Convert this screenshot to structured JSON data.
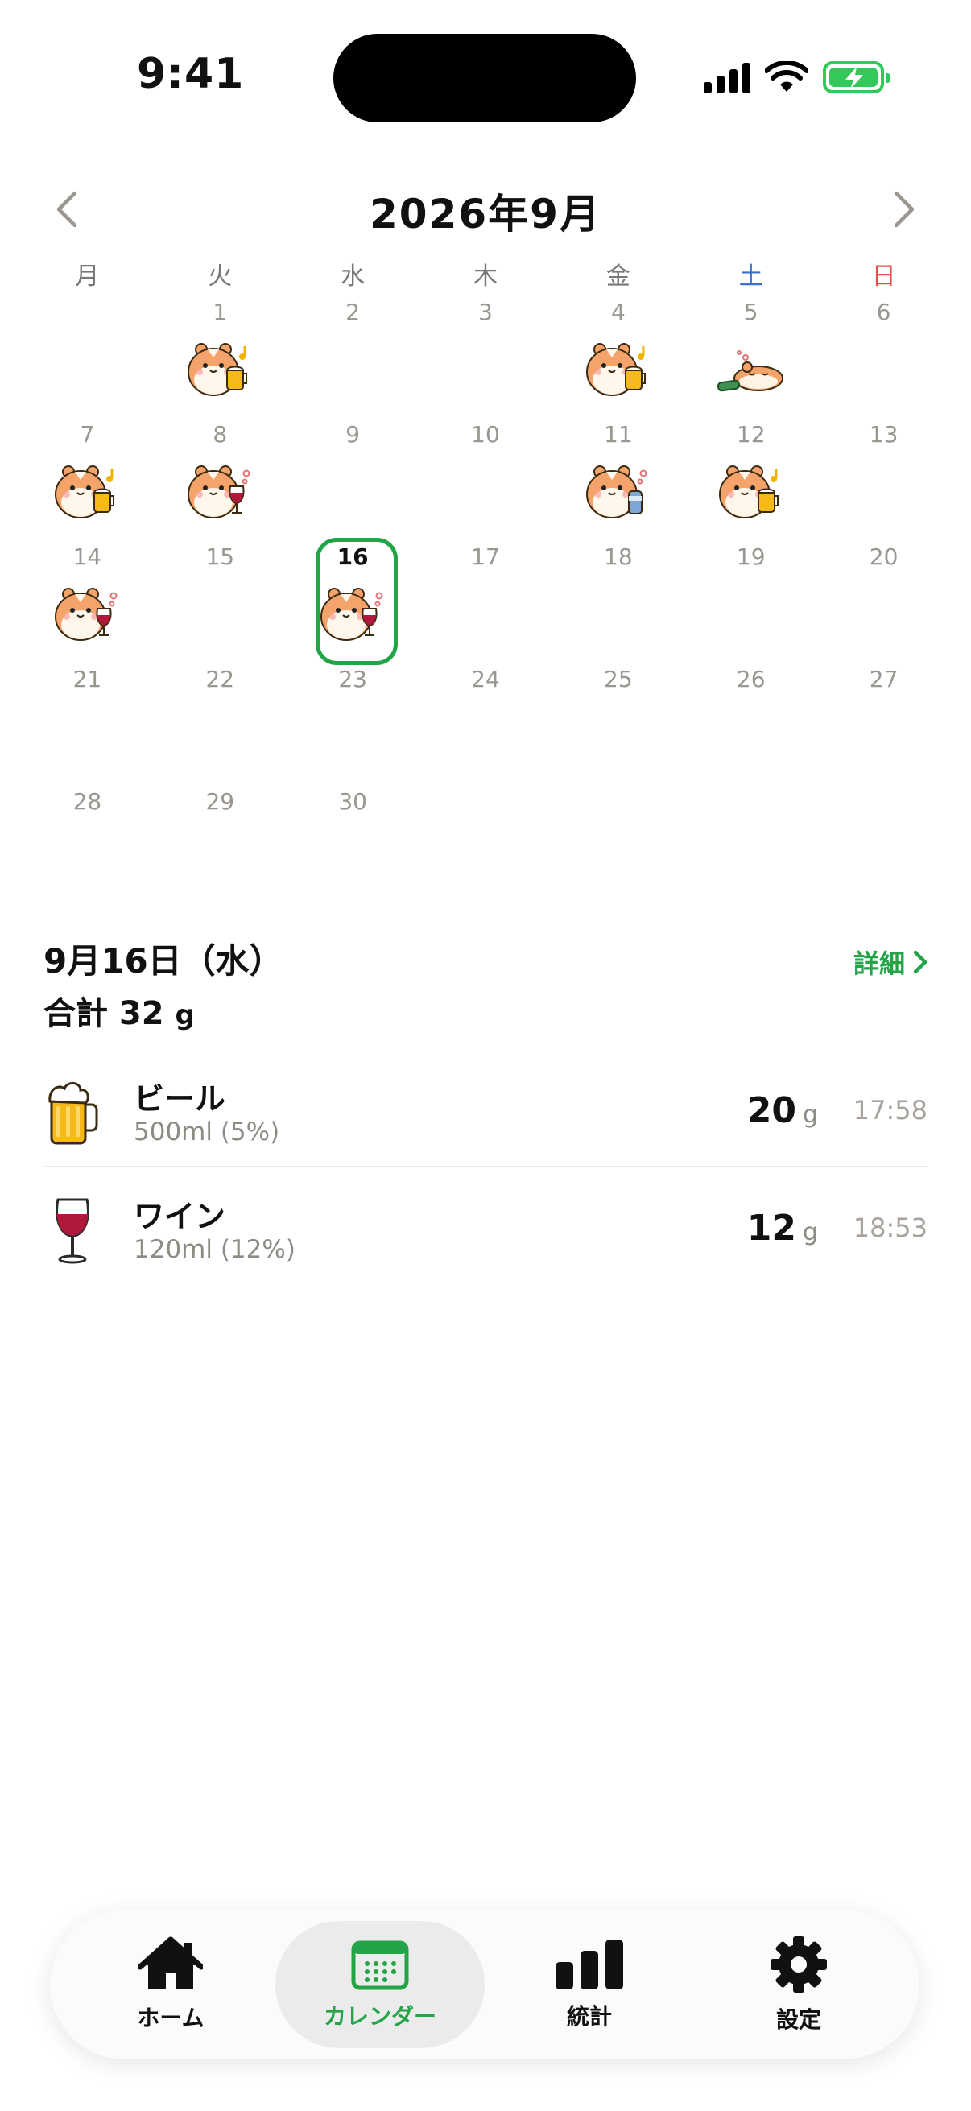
{
  "status_bar": {
    "time": "9:41"
  },
  "calendar": {
    "title": "2026年9月",
    "weekdays": [
      "月",
      "火",
      "水",
      "木",
      "金",
      "土",
      "日"
    ],
    "days": [
      {
        "day": "",
        "sticker": ""
      },
      {
        "day": "1",
        "sticker": "beer"
      },
      {
        "day": "2",
        "sticker": ""
      },
      {
        "day": "3",
        "sticker": ""
      },
      {
        "day": "4",
        "sticker": "beer"
      },
      {
        "day": "5",
        "sticker": "sleep"
      },
      {
        "day": "6",
        "sticker": ""
      },
      {
        "day": "7",
        "sticker": "beer"
      },
      {
        "day": "8",
        "sticker": "wine"
      },
      {
        "day": "9",
        "sticker": ""
      },
      {
        "day": "10",
        "sticker": ""
      },
      {
        "day": "11",
        "sticker": "can"
      },
      {
        "day": "12",
        "sticker": "beer"
      },
      {
        "day": "13",
        "sticker": ""
      },
      {
        "day": "14",
        "sticker": "wine"
      },
      {
        "day": "15",
        "sticker": ""
      },
      {
        "day": "16",
        "sticker": "wine",
        "selected": true
      },
      {
        "day": "17",
        "sticker": ""
      },
      {
        "day": "18",
        "sticker": ""
      },
      {
        "day": "19",
        "sticker": ""
      },
      {
        "day": "20",
        "sticker": ""
      },
      {
        "day": "21",
        "sticker": ""
      },
      {
        "day": "22",
        "sticker": ""
      },
      {
        "day": "23",
        "sticker": ""
      },
      {
        "day": "24",
        "sticker": ""
      },
      {
        "day": "25",
        "sticker": ""
      },
      {
        "day": "26",
        "sticker": ""
      },
      {
        "day": "27",
        "sticker": ""
      },
      {
        "day": "28",
        "sticker": ""
      },
      {
        "day": "29",
        "sticker": ""
      },
      {
        "day": "30",
        "sticker": ""
      }
    ]
  },
  "detail": {
    "date": "9月16日（水）",
    "total_label": "合計",
    "total_value": "32",
    "total_unit": "g",
    "link_label": "詳細",
    "entries": [
      {
        "name": "ビール",
        "sub": "500ml (5%)",
        "grams": "20",
        "unit": "g",
        "time": "17:58",
        "icon": "beer-mug-icon"
      },
      {
        "name": "ワイン",
        "sub": "120ml (12%)",
        "grams": "12",
        "unit": "g",
        "time": "18:53",
        "icon": "wine-glass-icon"
      }
    ]
  },
  "tabbar": {
    "tabs": [
      {
        "label": "ホーム",
        "icon": "home-icon"
      },
      {
        "label": "カレンダー",
        "icon": "calendar-icon",
        "active": true
      },
      {
        "label": "統計",
        "icon": "bar-chart-icon"
      },
      {
        "label": "設定",
        "icon": "gear-icon"
      }
    ]
  },
  "colors": {
    "accent": "#22a447",
    "saturday": "#3d6fd1",
    "sunday": "#e0514b",
    "battery": "#34c759"
  }
}
